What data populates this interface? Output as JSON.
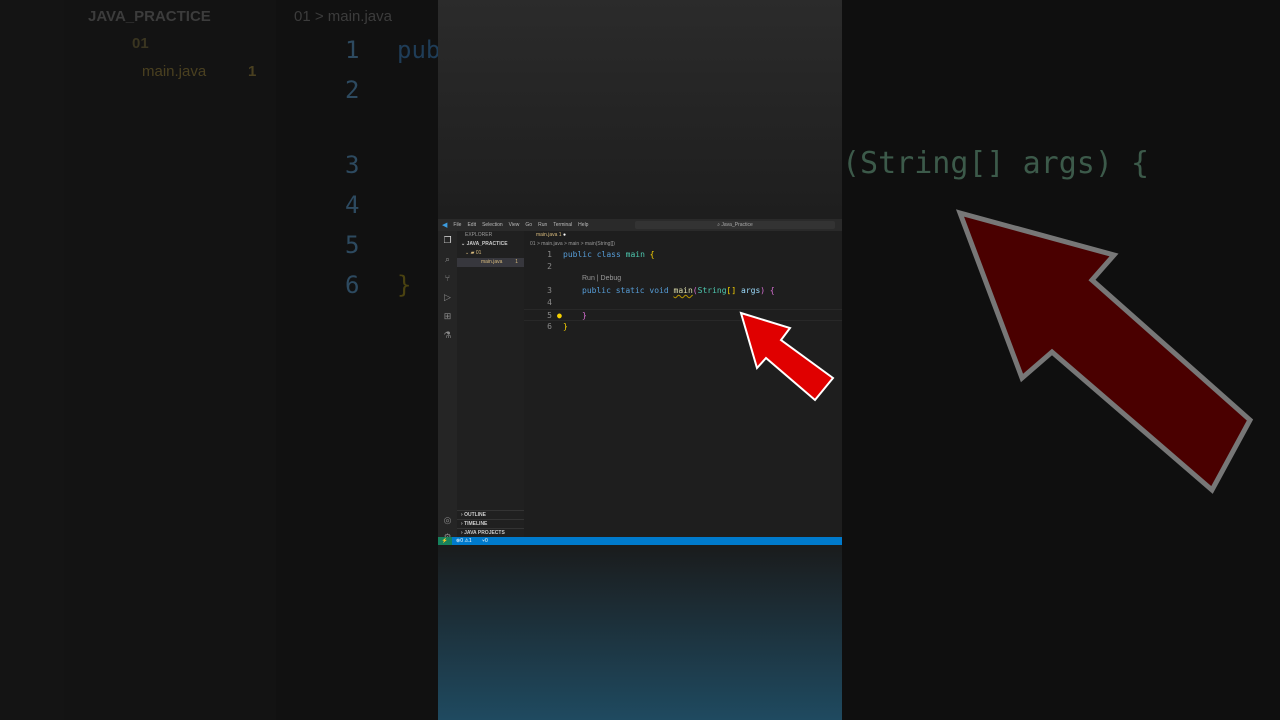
{
  "background_left": {
    "folder": "JAVA_PRACTICE",
    "subfolder": "01",
    "file": "main.java",
    "badge": "1",
    "breadcrumb": "01 > main.java",
    "code_fragment": "publ",
    "line_numbers": [
      "1",
      "2",
      "3",
      "4",
      "5",
      "6"
    ],
    "closing_brace": "}"
  },
  "background_right": {
    "code_fragment": "(String[] args) {"
  },
  "vscode": {
    "menu": [
      "File",
      "Edit",
      "Selection",
      "View",
      "Go",
      "Run",
      "Terminal",
      "Help"
    ],
    "search": "Java_Practice",
    "explorer": {
      "title": "EXPLORER",
      "root": "JAVA_PRACTICE",
      "folder": "01",
      "file": "main.java",
      "file_badge": "1",
      "sections": [
        "OUTLINE",
        "TIMELINE",
        "JAVA PROJECTS"
      ]
    },
    "tab": "main.java 1",
    "breadcrumb": "01 > main.java > main > main(String[])",
    "codelens": "Run | Debug",
    "status": {
      "errors": "0",
      "warnings": "1",
      "ports": "0"
    }
  },
  "colors": {
    "accent": "#007acc",
    "arrow": "#e00000"
  }
}
